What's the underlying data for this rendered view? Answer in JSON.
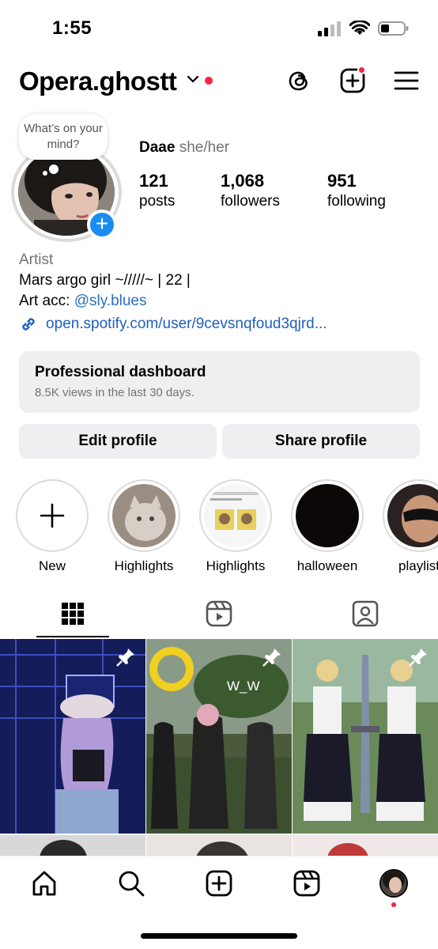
{
  "status_bar": {
    "time": "1:55"
  },
  "header": {
    "username": "Opera.ghostt"
  },
  "profile": {
    "thought_bubble": "What’s on your mind?",
    "display_name": "Daae",
    "pronouns": "she/her",
    "stats": [
      {
        "value": "121",
        "label": "posts"
      },
      {
        "value": "1,068",
        "label": "followers"
      },
      {
        "value": "951",
        "label": "following"
      }
    ],
    "category": "Artist",
    "bio_line1": "Mars argo girl ~/////~ | 22 |",
    "bio_line2_prefix": "Art acc: ",
    "bio_line2_mention": "@sly.blues",
    "link": "open.spotify.com/user/9cevsnqfoud3qjrd..."
  },
  "professional_dashboard": {
    "title": "Professional dashboard",
    "subtitle": "8.5K views in the last 30 days."
  },
  "buttons": {
    "edit": "Edit profile",
    "share": "Share profile"
  },
  "highlights": [
    {
      "label": "New",
      "icon": "plus-icon"
    },
    {
      "label": "Highlights"
    },
    {
      "label": "Highlights"
    },
    {
      "label": "halloween"
    },
    {
      "label": "playlist"
    }
  ],
  "tabs": {
    "grid": "grid-icon",
    "reels": "reels-icon",
    "tagged": "tagged-icon",
    "active": "grid"
  },
  "grid_post_overlay_text": "W_W",
  "colors": {
    "accent_blue": "#1a8cf3",
    "notification_red": "#ff2040",
    "link_blue": "#1f5fbf"
  }
}
